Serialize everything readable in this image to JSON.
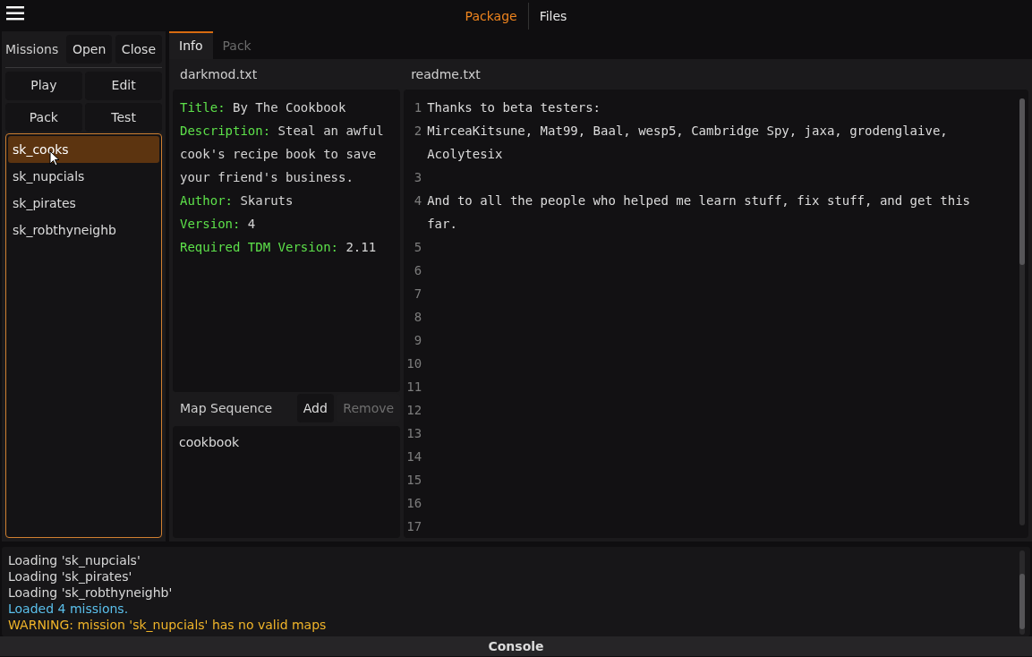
{
  "top_tabs": [
    {
      "label": "Package",
      "selected": true
    },
    {
      "label": "Files",
      "selected": false
    }
  ],
  "missions": {
    "label": "Missions",
    "buttons": [
      "Open",
      "Close"
    ],
    "actions": [
      "Play",
      "Edit",
      "Pack",
      "Test"
    ],
    "items": [
      {
        "label": "sk_cooks",
        "selected": true
      },
      {
        "label": "sk_nupcials",
        "selected": false
      },
      {
        "label": "sk_pirates",
        "selected": false
      },
      {
        "label": "sk_robthyneighb",
        "selected": false
      }
    ]
  },
  "tabs": [
    {
      "label": "Info",
      "selected": true
    },
    {
      "label": "Pack",
      "selected": false
    }
  ],
  "darkmod": {
    "filename": "darkmod.txt",
    "fields": [
      {
        "key": "Title:",
        "value": "By The Cookbook"
      },
      {
        "key": "Description:",
        "value": "Steal an awful cook's recipe book to save your friend's business."
      },
      {
        "key": "Author:",
        "value": "Skaruts"
      },
      {
        "key": "Version:",
        "value": "4"
      },
      {
        "key": "Required TDM Version:",
        "value": "2.11"
      }
    ]
  },
  "map_sequence": {
    "label": "Map Sequence",
    "buttons": [
      {
        "label": "Add",
        "disabled": false
      },
      {
        "label": "Remove",
        "disabled": true
      }
    ],
    "items": [
      "cookbook"
    ]
  },
  "readme": {
    "filename": "readme.txt",
    "lines": [
      {
        "number": "1",
        "text": "Thanks to beta testers:"
      },
      {
        "number": "2",
        "text": "MirceaKitsune, Mat99, Baal, wesp5, Cambridge Spy, jaxa, grodenglaive, Acolytesix"
      },
      {
        "number": "3"
      },
      {
        "number": "4",
        "text": "And to all the people who helped me learn stuff, fix stuff, and get this far."
      },
      {
        "number": "5"
      },
      {
        "number": "6"
      },
      {
        "number": "7"
      },
      {
        "number": "8"
      },
      {
        "number": "9"
      },
      {
        "number": "10"
      },
      {
        "number": "11"
      },
      {
        "number": "12"
      },
      {
        "number": "13"
      },
      {
        "number": "14"
      },
      {
        "number": "15"
      },
      {
        "number": "16"
      },
      {
        "number": "17"
      }
    ]
  },
  "console": {
    "title": "Console",
    "lines": [
      {
        "text": "Loading 'sk_nupcials'",
        "kind": "info"
      },
      {
        "text": "Loading 'sk_pirates'",
        "kind": "info"
      },
      {
        "text": "Loading 'sk_robthyneighb'",
        "kind": "info"
      },
      {
        "text": "Loaded 4 missions.",
        "kind": "success"
      },
      {
        "text": "WARNING: mission 'sk_nupcials' has no valid maps",
        "kind": "warning"
      }
    ]
  }
}
